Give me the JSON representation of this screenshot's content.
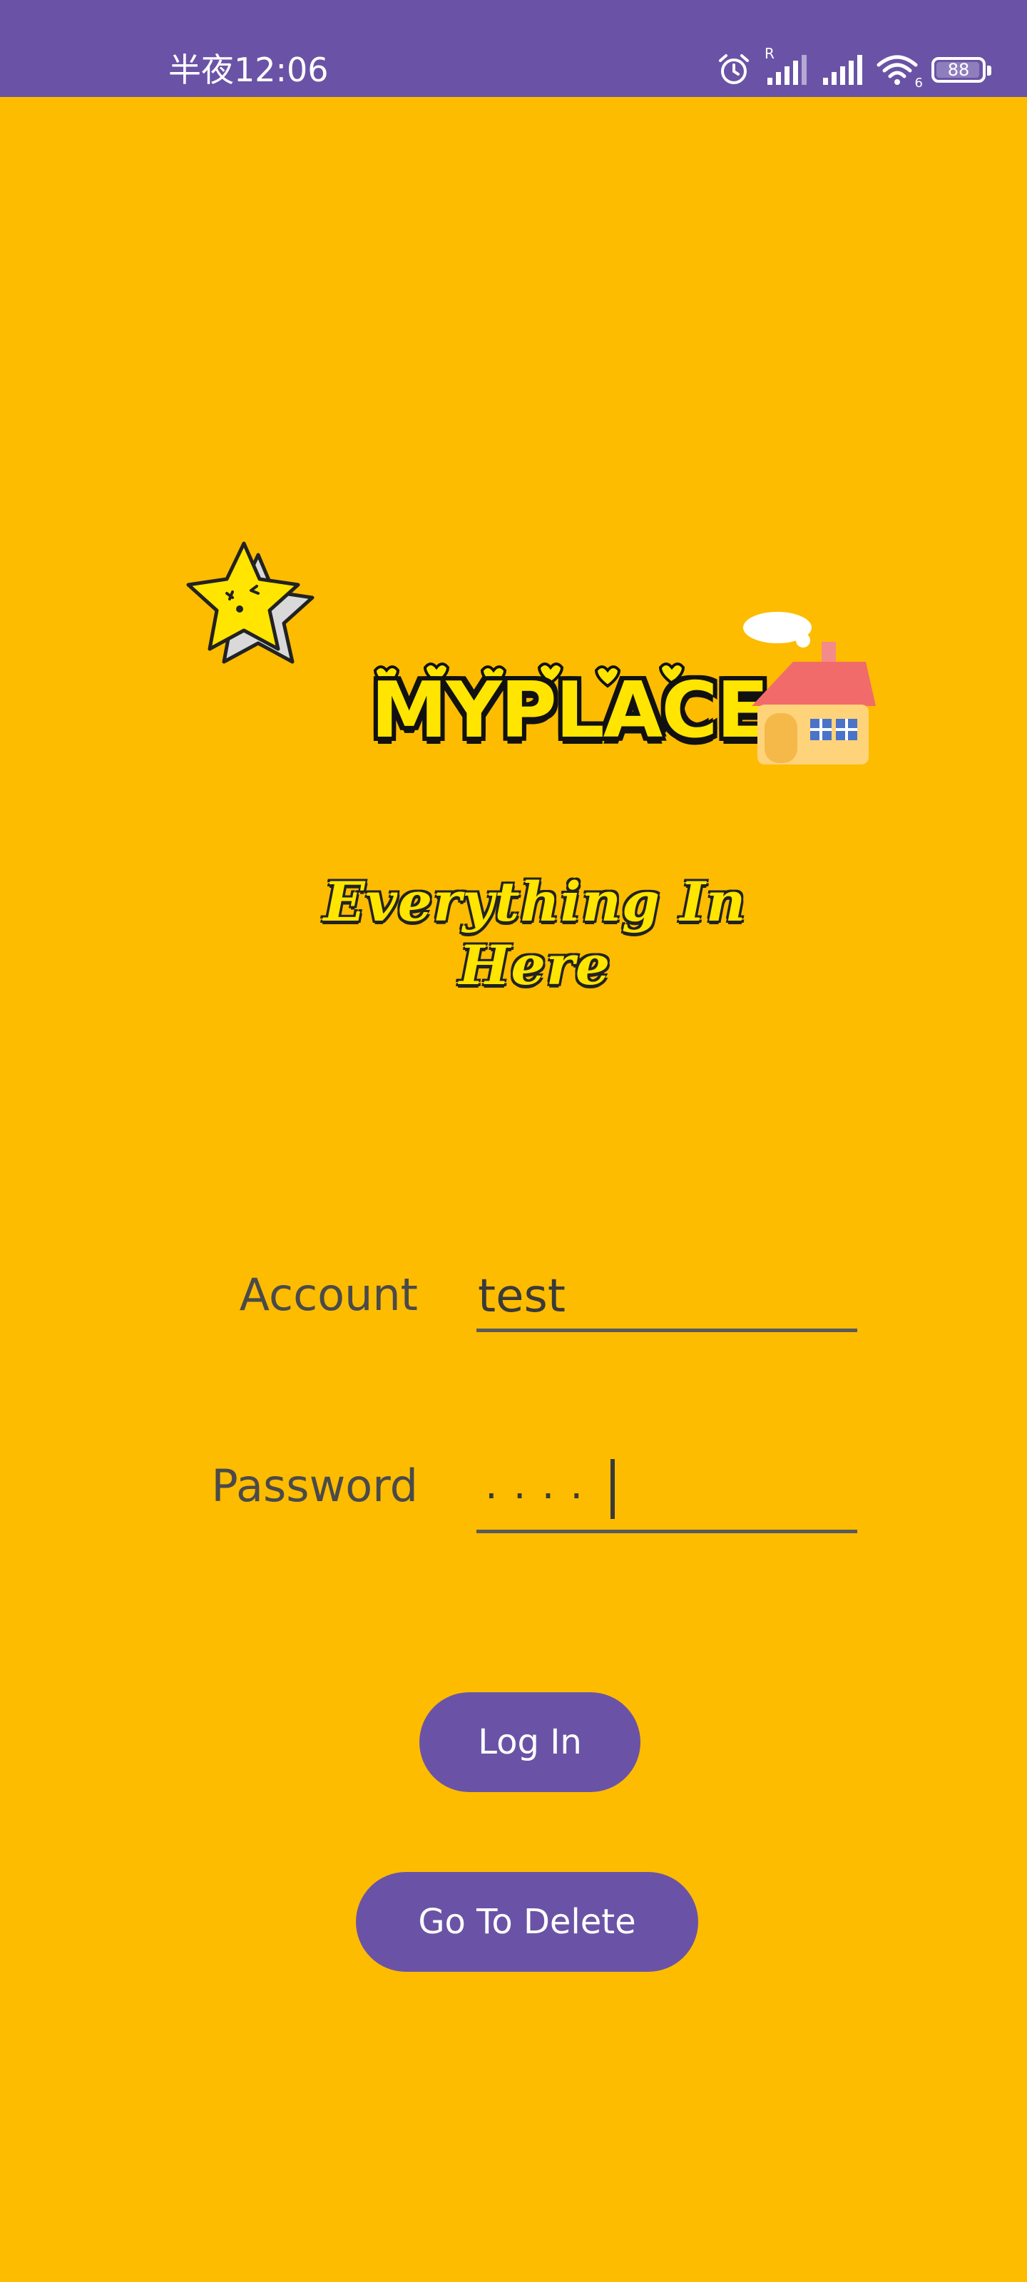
{
  "status_bar": {
    "time": "半夜12:06",
    "battery": "88",
    "roaming_label": "R",
    "wifi_label": "6",
    "icons": [
      "alarm-icon",
      "signal-icon",
      "signal-icon",
      "wifi-icon",
      "battery-icon"
    ]
  },
  "branding": {
    "logo_text": "MYPLACE",
    "tagline": "Everything In Here"
  },
  "form": {
    "account_label": "Account",
    "account_value": "test",
    "password_label": "Password",
    "password_mask": "····"
  },
  "buttons": {
    "login_label": "Log In",
    "delete_label": "Go To Delete"
  },
  "colors": {
    "background": "#FDBC00",
    "status_bar": "#6A53A6",
    "button": "#6A53A6",
    "logo_fill": "#FFE500"
  }
}
